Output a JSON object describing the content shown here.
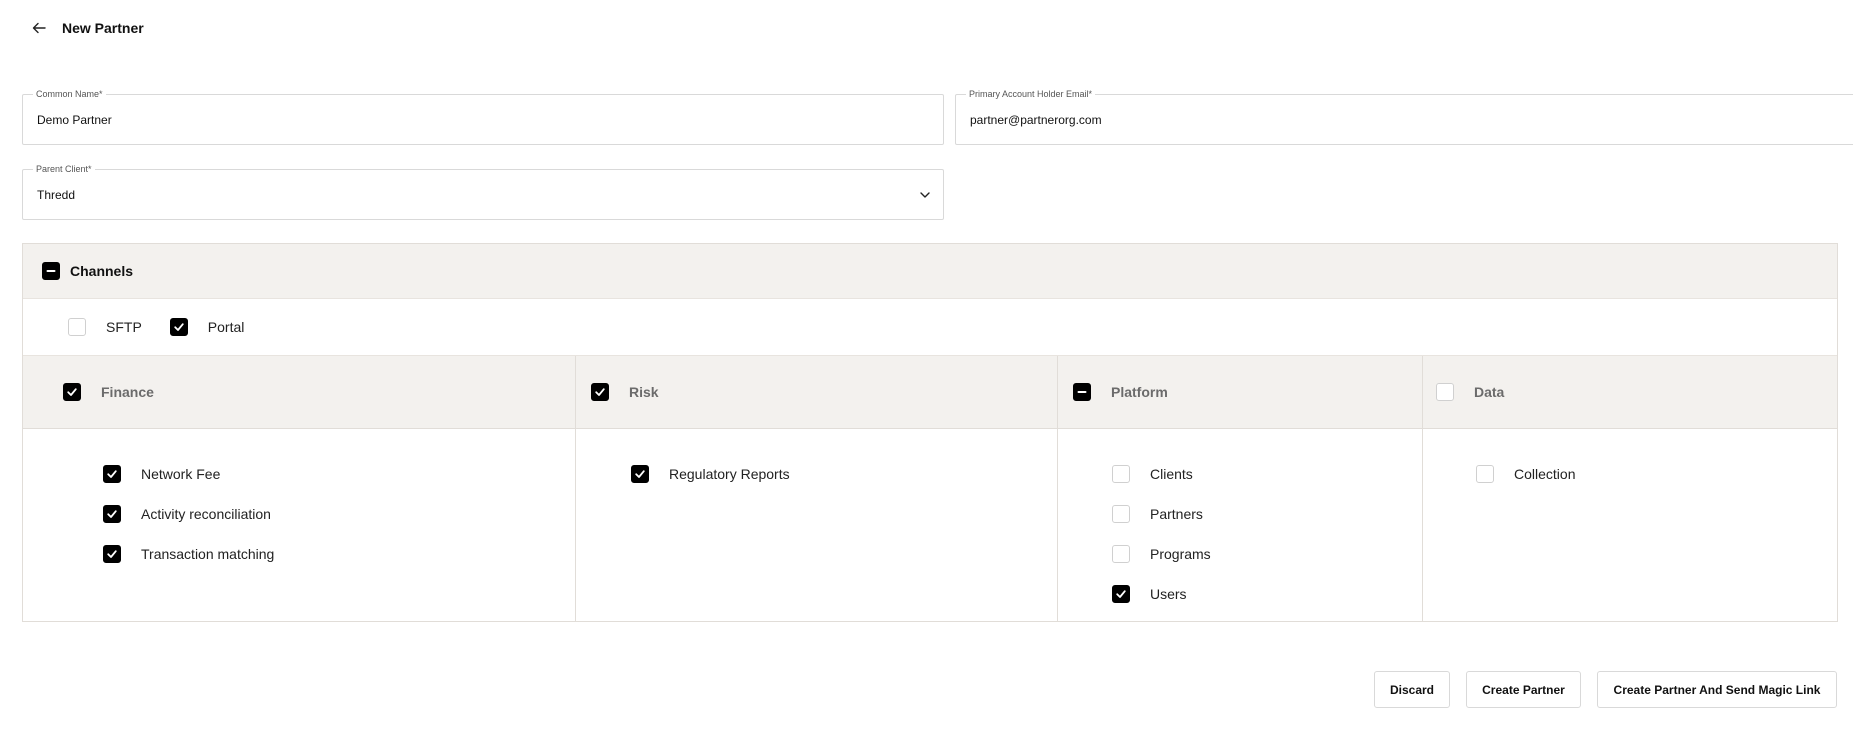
{
  "header": {
    "title": "New Partner",
    "back_icon": "arrow-left-icon"
  },
  "form": {
    "common_name": {
      "label": "Common Name*",
      "value": "Demo Partner"
    },
    "email": {
      "label": "Primary Account Holder Email*",
      "value": "partner@partnerorg.com"
    },
    "parent_client": {
      "label": "Parent Client*",
      "value": "Thredd"
    }
  },
  "channels": {
    "title": "Channels",
    "state": "indeterminate",
    "options": [
      {
        "label": "SFTP",
        "checked": false
      },
      {
        "label": "Portal",
        "checked": true
      }
    ],
    "groups": [
      {
        "title": "Finance",
        "state": "checked",
        "items": [
          {
            "label": "Network Fee",
            "checked": true
          },
          {
            "label": "Activity reconciliation",
            "checked": true
          },
          {
            "label": "Transaction matching",
            "checked": true
          }
        ]
      },
      {
        "title": "Risk",
        "state": "checked",
        "items": [
          {
            "label": "Regulatory Reports",
            "checked": true
          }
        ]
      },
      {
        "title": "Platform",
        "state": "indeterminate",
        "items": [
          {
            "label": "Clients",
            "checked": false
          },
          {
            "label": "Partners",
            "checked": false
          },
          {
            "label": "Programs",
            "checked": false
          },
          {
            "label": "Users",
            "checked": true
          }
        ]
      },
      {
        "title": "Data",
        "state": "unchecked",
        "items": [
          {
            "label": "Collection",
            "checked": false
          }
        ]
      }
    ]
  },
  "footer": {
    "discard": "Discard",
    "create": "Create Partner",
    "create_send": "Create Partner And Send Magic Link"
  },
  "colors": {
    "header_bg": "#f3f1ee",
    "checkbox_on": "#000000",
    "border": "#d9d9d9"
  }
}
